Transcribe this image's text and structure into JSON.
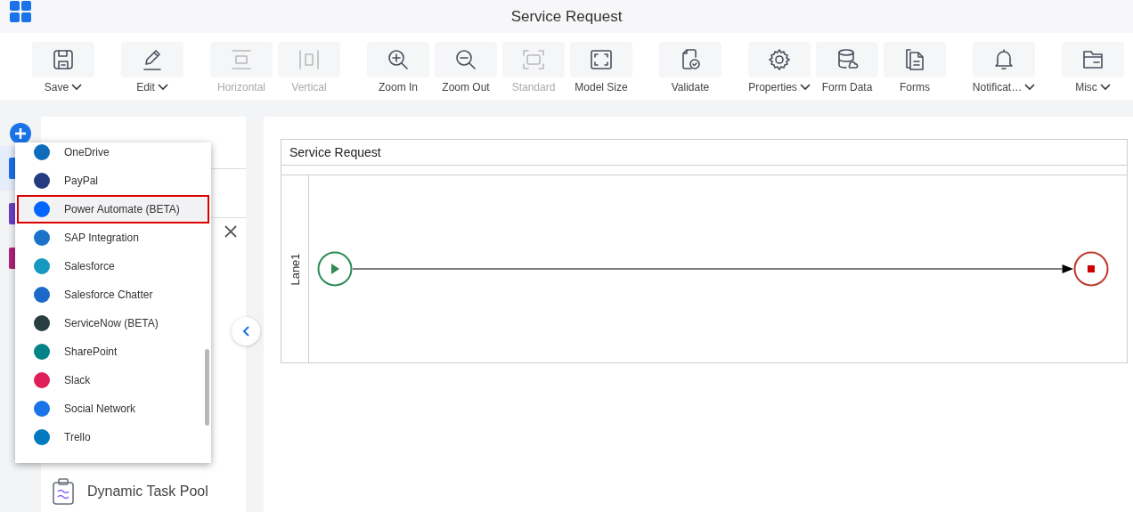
{
  "window": {
    "title": "Service Request"
  },
  "toolbar": {
    "groups": [
      [
        {
          "label": "Save",
          "disabled": false,
          "dropdown": true
        }
      ],
      [
        {
          "label": "Edit",
          "disabled": false,
          "dropdown": true
        }
      ],
      [
        {
          "label": "Horizontal",
          "disabled": true,
          "dropdown": false
        },
        {
          "label": "Vertical",
          "disabled": true,
          "dropdown": false
        }
      ],
      [
        {
          "label": "Zoom In",
          "disabled": false,
          "dropdown": false
        },
        {
          "label": "Zoom Out",
          "disabled": false,
          "dropdown": false
        },
        {
          "label": "Standard",
          "disabled": true,
          "dropdown": false
        },
        {
          "label": "Model Size",
          "disabled": false,
          "dropdown": false
        }
      ],
      [
        {
          "label": "Validate",
          "disabled": false,
          "dropdown": false
        }
      ],
      [
        {
          "label": "Properties",
          "disabled": false,
          "dropdown": true
        },
        {
          "label": "Form Data",
          "disabled": false,
          "dropdown": false
        },
        {
          "label": "Forms",
          "disabled": false,
          "dropdown": false
        }
      ],
      [
        {
          "label": "Notificat…",
          "disabled": false,
          "dropdown": true
        }
      ],
      [
        {
          "label": "Misc",
          "disabled": false,
          "dropdown": true
        }
      ]
    ]
  },
  "sidebar": {
    "items": [
      {
        "label": "Dynamic Task Pool"
      }
    ]
  },
  "menu": {
    "items": [
      {
        "label": "OneDrive",
        "selected": false,
        "color": "#0f6cbd"
      },
      {
        "label": "PayPal",
        "selected": false,
        "color": "#253b80"
      },
      {
        "label": "Power Automate (BETA)",
        "selected": true,
        "color": "#0066ff"
      },
      {
        "label": "SAP Integration",
        "selected": false,
        "color": "#1a73c8"
      },
      {
        "label": "Salesforce",
        "selected": false,
        "color": "#1798c1"
      },
      {
        "label": "Salesforce Chatter",
        "selected": false,
        "color": "#1b6ac9"
      },
      {
        "label": "ServiceNow (BETA)",
        "selected": false,
        "color": "#293e40"
      },
      {
        "label": "SharePoint",
        "selected": false,
        "color": "#038387"
      },
      {
        "label": "Slack",
        "selected": false,
        "color": "#e01e5a"
      },
      {
        "label": "Social Network",
        "selected": false,
        "color": "#1a73e8"
      },
      {
        "label": "Trello",
        "selected": false,
        "color": "#0079bf"
      }
    ]
  },
  "canvas": {
    "pool": {
      "title": "Service Request",
      "lanes": [
        {
          "label": "Lane1"
        }
      ]
    }
  }
}
